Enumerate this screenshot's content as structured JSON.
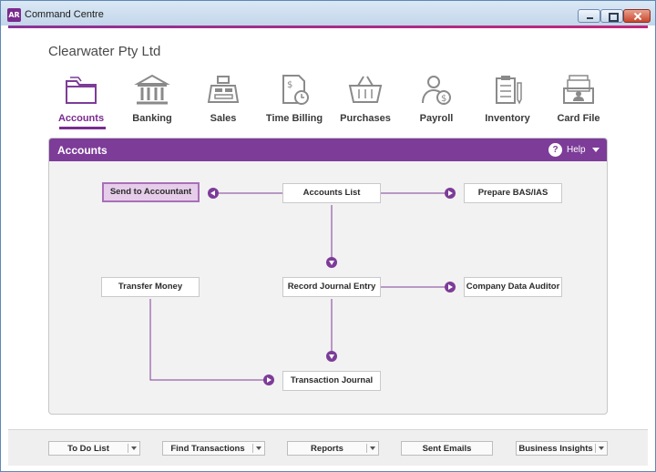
{
  "window": {
    "app_badge": "AR",
    "title": "Command Centre"
  },
  "company": "Clearwater Pty Ltd",
  "nav": {
    "items": [
      {
        "label": "Accounts",
        "icon": "folder-icon",
        "active": true
      },
      {
        "label": "Banking",
        "icon": "bank-icon"
      },
      {
        "label": "Sales",
        "icon": "cash-register-icon"
      },
      {
        "label": "Time Billing",
        "icon": "timesheet-clock-icon"
      },
      {
        "label": "Purchases",
        "icon": "basket-icon"
      },
      {
        "label": "Payroll",
        "icon": "person-dollar-icon"
      },
      {
        "label": "Inventory",
        "icon": "checklist-icon"
      },
      {
        "label": "Card File",
        "icon": "card-file-icon"
      }
    ]
  },
  "panel": {
    "title": "Accounts",
    "help_label": "Help",
    "help_symbol": "?"
  },
  "flow": {
    "send_to_accountant": "Send to Accountant",
    "accounts_list": "Accounts List",
    "prepare_bas": "Prepare BAS/IAS",
    "transfer_money": "Transfer Money",
    "record_journal_entry": "Record Journal Entry",
    "company_data_auditor": "Company Data Auditor",
    "transaction_journal": "Transaction Journal"
  },
  "footer": {
    "todo": "To Do List",
    "find": "Find Transactions",
    "reports": "Reports",
    "sent_emails": "Sent Emails",
    "insights": "Business Insights"
  },
  "colors": {
    "accent": "#7d3c98",
    "highlight": "#e6cdea",
    "icon_gray": "#8a8a8a"
  }
}
